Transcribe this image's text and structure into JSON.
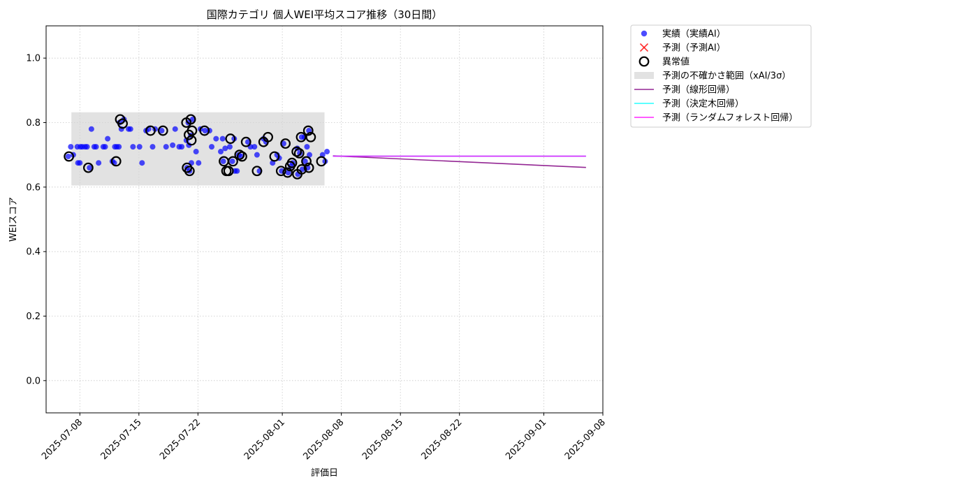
{
  "chart_data": {
    "type": "scatter",
    "title": "国際カテゴリ 個人WEI平均スコア推移（30日間）",
    "xlabel": "評価日",
    "ylabel": "WEIスコア",
    "xlim": [
      "2025-07-04",
      "2025-09-08"
    ],
    "ylim": [
      -0.1,
      1.1
    ],
    "x_ticks": [
      "2025-07-08",
      "2025-07-15",
      "2025-07-22",
      "2025-08-01",
      "2025-08-08",
      "2025-08-15",
      "2025-08-22",
      "2025-09-01",
      "2025-09-08"
    ],
    "y_ticks": [
      "0.0",
      "0.2",
      "0.4",
      "0.6",
      "0.8",
      "1.0"
    ],
    "grid": true,
    "legend_position": "outside-right-top",
    "colors": {
      "actual": "#0000ff",
      "predicted": "#ff0000",
      "outlier": "#000000",
      "uncertainty": "#d3d3d3",
      "linear": "#800080",
      "tree": "#00ffff",
      "forest": "#ff00ff"
    },
    "legend": [
      {
        "key": "actual",
        "label": "実績（実績AI）",
        "marker": "dot"
      },
      {
        "key": "predicted",
        "label": "予測（予測AI）",
        "marker": "x"
      },
      {
        "key": "outlier",
        "label": "異常値",
        "marker": "ring"
      },
      {
        "key": "uncertainty",
        "label": "予測の不確かさ範囲（xAI/3σ）",
        "marker": "band"
      },
      {
        "key": "linear",
        "label": "予測（線形回帰）",
        "marker": "line"
      },
      {
        "key": "tree",
        "label": "予測（決定木回帰）",
        "marker": "line"
      },
      {
        "key": "forest",
        "label": "予測（ランダムフォレスト回帰）",
        "marker": "line"
      }
    ],
    "uncertainty_band": {
      "x_start": "2025-07-07",
      "x_end": "2025-08-06",
      "y_low": 0.605,
      "y_high": 0.832
    },
    "actual_points": [
      [
        "2025-07-07",
        0.695
      ],
      [
        "2025-07-07",
        0.725
      ],
      [
        "2025-07-07",
        0.7
      ],
      [
        "2025-07-08",
        0.725
      ],
      [
        "2025-07-08",
        0.675
      ],
      [
        "2025-07-08",
        0.725
      ],
      [
        "2025-07-08",
        0.675
      ],
      [
        "2025-07-08",
        0.725
      ],
      [
        "2025-07-09",
        0.78
      ],
      [
        "2025-07-09",
        0.725
      ],
      [
        "2025-07-09",
        0.66
      ],
      [
        "2025-07-09",
        0.725
      ],
      [
        "2025-07-10",
        0.725
      ],
      [
        "2025-07-10",
        0.675
      ],
      [
        "2025-07-10",
        0.725
      ],
      [
        "2025-07-11",
        0.725
      ],
      [
        "2025-07-11",
        0.75
      ],
      [
        "2025-07-11",
        0.725
      ],
      [
        "2025-07-12",
        0.675
      ],
      [
        "2025-07-12",
        0.725
      ],
      [
        "2025-07-12",
        0.68
      ],
      [
        "2025-07-12",
        0.725
      ],
      [
        "2025-07-13",
        0.725
      ],
      [
        "2025-07-13",
        0.78
      ],
      [
        "2025-07-13",
        0.81
      ],
      [
        "2025-07-13",
        0.8
      ],
      [
        "2025-07-14",
        0.78
      ],
      [
        "2025-07-14",
        0.725
      ],
      [
        "2025-07-14",
        0.78
      ],
      [
        "2025-07-15",
        0.725
      ],
      [
        "2025-07-15",
        0.675
      ],
      [
        "2025-07-16",
        0.775
      ],
      [
        "2025-07-16",
        0.78
      ],
      [
        "2025-07-17",
        0.725
      ],
      [
        "2025-07-17",
        0.78
      ],
      [
        "2025-07-18",
        0.725
      ],
      [
        "2025-07-18",
        0.775
      ],
      [
        "2025-07-19",
        0.73
      ],
      [
        "2025-07-19",
        0.78
      ],
      [
        "2025-07-20",
        0.725
      ],
      [
        "2025-07-20",
        0.725
      ],
      [
        "2025-07-21",
        0.81
      ],
      [
        "2025-07-21",
        0.8
      ],
      [
        "2025-07-21",
        0.76
      ],
      [
        "2025-07-21",
        0.745
      ],
      [
        "2025-07-21",
        0.73
      ],
      [
        "2025-07-21",
        0.675
      ],
      [
        "2025-07-21",
        0.66
      ],
      [
        "2025-07-21",
        0.65
      ],
      [
        "2025-07-22",
        0.78
      ],
      [
        "2025-07-22",
        0.71
      ],
      [
        "2025-07-22",
        0.675
      ],
      [
        "2025-07-23",
        0.775
      ],
      [
        "2025-07-23",
        0.775
      ],
      [
        "2025-07-24",
        0.75
      ],
      [
        "2025-07-24",
        0.725
      ],
      [
        "2025-07-25",
        0.75
      ],
      [
        "2025-07-25",
        0.72
      ],
      [
        "2025-07-25",
        0.71
      ],
      [
        "2025-07-25",
        0.68
      ],
      [
        "2025-07-26",
        0.75
      ],
      [
        "2025-07-26",
        0.725
      ],
      [
        "2025-07-26",
        0.68
      ],
      [
        "2025-07-26",
        0.65
      ],
      [
        "2025-07-27",
        0.7
      ],
      [
        "2025-07-27",
        0.695
      ],
      [
        "2025-07-27",
        0.65
      ],
      [
        "2025-07-28",
        0.74
      ],
      [
        "2025-07-28",
        0.725
      ],
      [
        "2025-07-29",
        0.725
      ],
      [
        "2025-07-29",
        0.7
      ],
      [
        "2025-07-29",
        0.65
      ],
      [
        "2025-07-30",
        0.75
      ],
      [
        "2025-07-30",
        0.74
      ],
      [
        "2025-07-31",
        0.7
      ],
      [
        "2025-07-31",
        0.675
      ],
      [
        "2025-08-01",
        0.735
      ],
      [
        "2025-08-01",
        0.69
      ],
      [
        "2025-08-01",
        0.65
      ],
      [
        "2025-08-02",
        0.675
      ],
      [
        "2025-08-02",
        0.645
      ],
      [
        "2025-08-02",
        0.665
      ],
      [
        "2025-08-03",
        0.755
      ],
      [
        "2025-08-03",
        0.72
      ],
      [
        "2025-08-03",
        0.705
      ],
      [
        "2025-08-03",
        0.655
      ],
      [
        "2025-08-03",
        0.64
      ],
      [
        "2025-08-04",
        0.775
      ],
      [
        "2025-08-04",
        0.755
      ],
      [
        "2025-08-04",
        0.725
      ],
      [
        "2025-08-04",
        0.7
      ],
      [
        "2025-08-04",
        0.68
      ],
      [
        "2025-08-04",
        0.66
      ],
      [
        "2025-08-06",
        0.71
      ],
      [
        "2025-08-06",
        0.7
      ],
      [
        "2025-08-06",
        0.68
      ]
    ],
    "outliers": [
      [
        "2025-07-07",
        0.695
      ],
      [
        "2025-07-09",
        0.66
      ],
      [
        "2025-07-12",
        0.68
      ],
      [
        "2025-07-13",
        0.81
      ],
      [
        "2025-07-13",
        0.797
      ],
      [
        "2025-07-16",
        0.775
      ],
      [
        "2025-07-18",
        0.775
      ],
      [
        "2025-07-21",
        0.81
      ],
      [
        "2025-07-21",
        0.8
      ],
      [
        "2025-07-21",
        0.762
      ],
      [
        "2025-07-21",
        0.745
      ],
      [
        "2025-07-21",
        0.66
      ],
      [
        "2025-07-21",
        0.65
      ],
      [
        "2025-07-21",
        0.775
      ],
      [
        "2025-07-23",
        0.775
      ],
      [
        "2025-07-25",
        0.68
      ],
      [
        "2025-07-25",
        0.65
      ],
      [
        "2025-07-26",
        0.75
      ],
      [
        "2025-07-26",
        0.68
      ],
      [
        "2025-07-26",
        0.65
      ],
      [
        "2025-07-27",
        0.7
      ],
      [
        "2025-07-27",
        0.695
      ],
      [
        "2025-07-28",
        0.74
      ],
      [
        "2025-07-29",
        0.65
      ],
      [
        "2025-07-30",
        0.755
      ],
      [
        "2025-07-30",
        0.74
      ],
      [
        "2025-07-31",
        0.695
      ],
      [
        "2025-08-01",
        0.735
      ],
      [
        "2025-08-01",
        0.65
      ],
      [
        "2025-08-02",
        0.675
      ],
      [
        "2025-08-02",
        0.645
      ],
      [
        "2025-08-02",
        0.665
      ],
      [
        "2025-08-03",
        0.755
      ],
      [
        "2025-08-03",
        0.71
      ],
      [
        "2025-08-03",
        0.705
      ],
      [
        "2025-08-03",
        0.655
      ],
      [
        "2025-08-03",
        0.64
      ],
      [
        "2025-08-04",
        0.775
      ],
      [
        "2025-08-04",
        0.755
      ],
      [
        "2025-08-04",
        0.68
      ],
      [
        "2025-08-04",
        0.66
      ],
      [
        "2025-08-06",
        0.68
      ]
    ],
    "series": [
      {
        "key": "linear",
        "x": [
          "2025-08-07",
          "2025-09-06"
        ],
        "y": [
          0.697,
          0.661
        ]
      },
      {
        "key": "tree",
        "x": [
          "2025-08-07",
          "2025-09-06"
        ],
        "y": [
          0.696,
          0.696
        ]
      },
      {
        "key": "forest",
        "x": [
          "2025-08-07",
          "2025-09-06"
        ],
        "y": [
          0.696,
          0.696
        ]
      }
    ]
  }
}
